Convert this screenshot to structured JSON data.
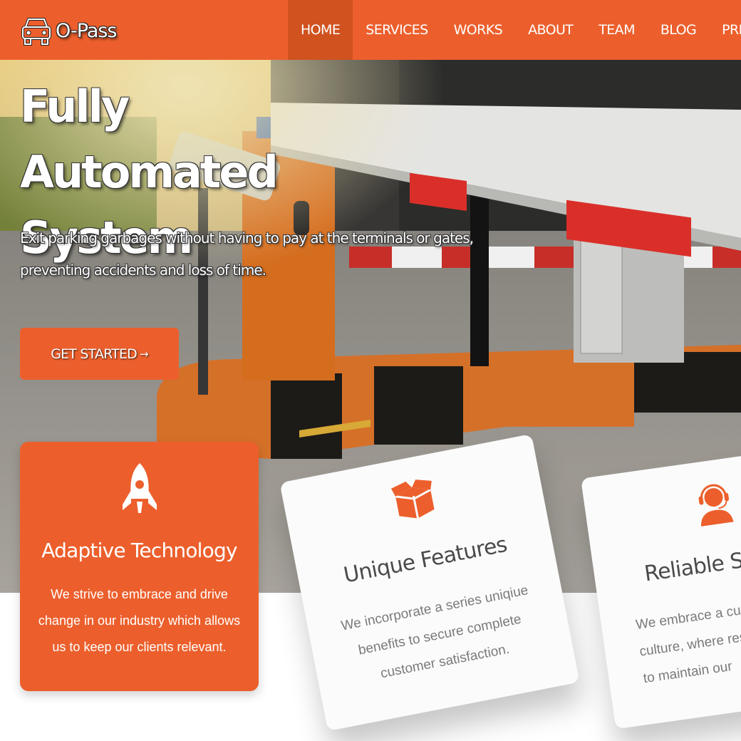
{
  "brand": {
    "name": "O-Pass",
    "icon": "car-icon"
  },
  "nav": {
    "items": [
      {
        "label": "HOME",
        "active": true
      },
      {
        "label": "SERVICES"
      },
      {
        "label": "WORKS"
      },
      {
        "label": "ABOUT"
      },
      {
        "label": "TEAM"
      },
      {
        "label": "BLOG"
      },
      {
        "label": "PRICING"
      }
    ]
  },
  "hero": {
    "title_line1": "Fully Automated",
    "title_line2": "System",
    "subtitle_line1": "Exit parking garbages without having to pay at the terminals or gates,",
    "subtitle_line2": "preventing accidents and loss of time.",
    "cta_label": "GET STARTED",
    "cta_arrow": "→"
  },
  "features": [
    {
      "icon": "rocket-icon",
      "title": "Adaptive Technology",
      "text": "We strive to embrace and drive change in our industry which allows us to keep our clients relevant."
    },
    {
      "icon": "open-box-icon",
      "title": "Unique Features",
      "text": "We incorporate a series uniqiue benefits to secure complete customer satisfaction."
    },
    {
      "icon": "headset-support-icon",
      "title": "Reliable Su",
      "text_line1": "We embrace a cus",
      "text_line2": "culture, where reso",
      "text_line3": "to maintain our"
    }
  ],
  "colors": {
    "accent": "#ec5f2c",
    "accent_dark": "#d0521f",
    "card_white": "#fbfbfb",
    "text_gray": "#7a7a7a"
  }
}
